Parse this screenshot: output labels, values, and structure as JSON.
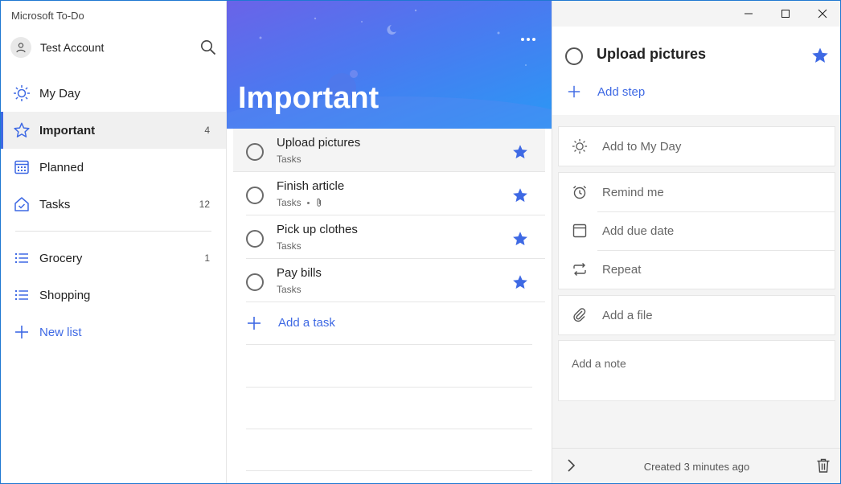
{
  "app": {
    "title": "Microsoft To-Do"
  },
  "account": {
    "name": "Test Account"
  },
  "sidebar": {
    "items": [
      {
        "label": "My Day",
        "count": "",
        "icon": "sun-icon"
      },
      {
        "label": "Important",
        "count": "4",
        "icon": "star-icon",
        "active": true
      },
      {
        "label": "Planned",
        "count": "",
        "icon": "calendar-icon"
      },
      {
        "label": "Tasks",
        "count": "12",
        "icon": "home-check-icon"
      }
    ],
    "lists": [
      {
        "label": "Grocery",
        "count": "1",
        "icon": "list-icon"
      },
      {
        "label": "Shopping",
        "count": "",
        "icon": "list-icon"
      }
    ],
    "new_list": "New list"
  },
  "main": {
    "title": "Important",
    "tasks": [
      {
        "title": "Upload pictures",
        "list": "Tasks",
        "attachment": false,
        "starred": true
      },
      {
        "title": "Finish article",
        "list": "Tasks",
        "attachment": true,
        "starred": true
      },
      {
        "title": "Pick up clothes",
        "list": "Tasks",
        "attachment": false,
        "starred": true
      },
      {
        "title": "Pay bills",
        "list": "Tasks",
        "attachment": false,
        "starred": true
      }
    ],
    "add_task": "Add a task"
  },
  "detail": {
    "title": "Upload pictures",
    "add_step": "Add step",
    "add_to_my_day": "Add to My Day",
    "remind_me": "Remind me",
    "add_due_date": "Add due date",
    "repeat": "Repeat",
    "add_file": "Add a file",
    "note_placeholder": "Add a note",
    "created": "Created 3 minutes ago"
  },
  "colors": {
    "accent": "#3e69e4",
    "star": "#3e69e4"
  }
}
